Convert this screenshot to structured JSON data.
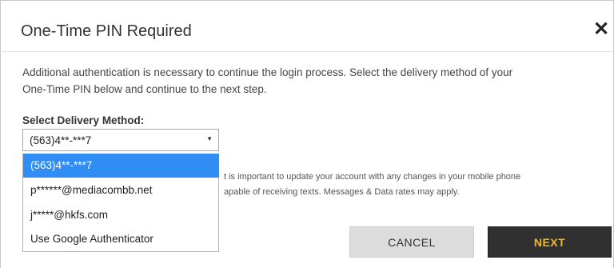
{
  "dialog": {
    "title": "One-Time PIN Required",
    "description_line1": "Additional authentication is necessary to continue the login process. Select the delivery method of your",
    "description_line2": "One-Time PIN below and continue to the next step.",
    "close_icon": "✕"
  },
  "delivery": {
    "label": "Select Delivery Method:",
    "selected_value": "(563)4**-***7",
    "caret": "▼",
    "options": [
      {
        "label": "(563)4**-***7",
        "selected": true
      },
      {
        "label": "p******@mediacombb.net",
        "selected": false
      },
      {
        "label": "j*****@hkfs.com",
        "selected": false
      },
      {
        "label": "Use Google Authenticator",
        "selected": false
      }
    ]
  },
  "notice": {
    "line1": "t is important to update your account with any changes in your mobile phone",
    "line2": "apable of receiving texts. Messages & Data rates may apply."
  },
  "buttons": {
    "cancel": "CANCEL",
    "next": "NEXT"
  },
  "colors": {
    "highlight": "#2f8df4",
    "next_bg": "#303030",
    "next_text": "#f0b81e"
  }
}
